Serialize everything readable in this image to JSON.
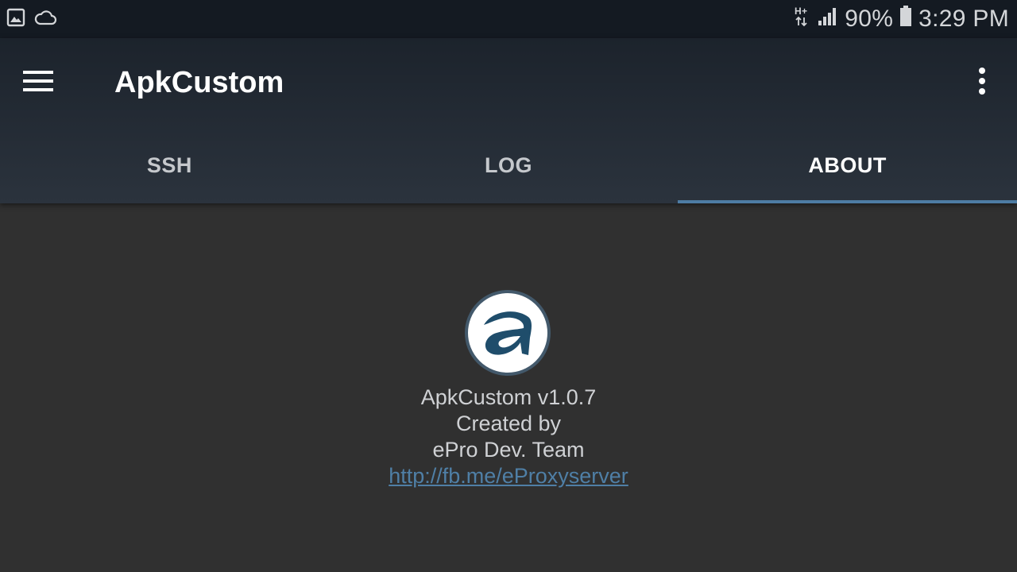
{
  "status_bar": {
    "left_icons": [
      "image-icon",
      "cloud-icon"
    ],
    "network_type": "H+",
    "battery_percent": "90%",
    "time": "3:29 PM"
  },
  "toolbar": {
    "menu_icon": "hamburger-menu-icon",
    "title": "ApkCustom",
    "overflow_icon": "more-vert-icon"
  },
  "tabs": [
    {
      "label": "SSH",
      "active": false
    },
    {
      "label": "LOG",
      "active": false
    },
    {
      "label": "ABOUT",
      "active": true
    }
  ],
  "about": {
    "logo_icon": "apkcustom-logo-icon",
    "version_line": "ApkCustom v1.0.7",
    "created_by_line": "Created by",
    "team_line": "ePro Dev. Team",
    "link": "http://fb.me/eProxyserver"
  },
  "colors": {
    "statusbar_bg": "#141a22",
    "appbar_bg": "#2b333d",
    "content_bg": "#303030",
    "accent": "#4d7ca3",
    "link": "#4f7fa6",
    "logo_blue": "#1f4d6b"
  }
}
